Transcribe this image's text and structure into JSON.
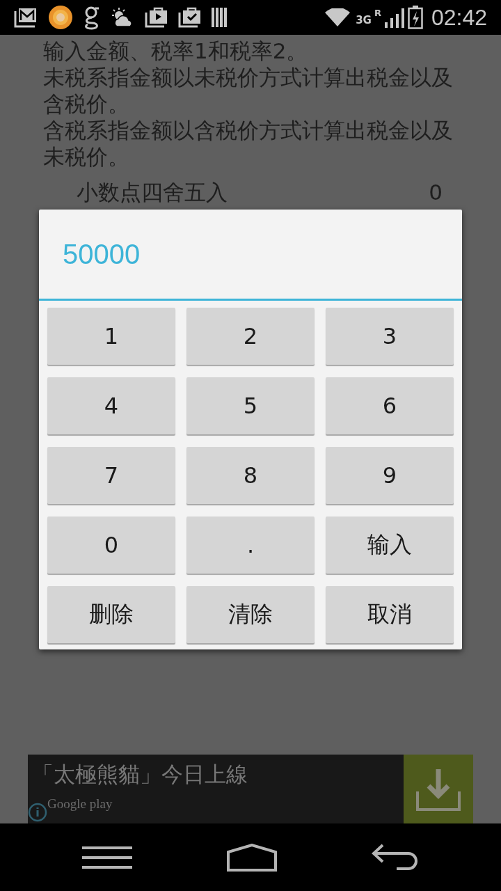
{
  "status_bar": {
    "network": "3G",
    "roaming": "R",
    "time": "02:42"
  },
  "background": {
    "paragraphs": [
      "输入金额、税率1和税率2。",
      "未税系指金额以未税价方式计算出税金以及含税价。",
      "含税系指金额以含税价方式计算出税金以及未税价。"
    ],
    "setting": {
      "label": "小数点四舍五入",
      "value": "0"
    }
  },
  "keypad_dialog": {
    "display": "50000",
    "keys": [
      "1",
      "2",
      "3",
      "4",
      "5",
      "6",
      "7",
      "8",
      "9",
      "0",
      ".",
      "输入",
      "删除",
      "清除",
      "取消"
    ]
  },
  "ad_banner": {
    "headline": "「太極熊貓」今日上線",
    "store": "Google play"
  }
}
